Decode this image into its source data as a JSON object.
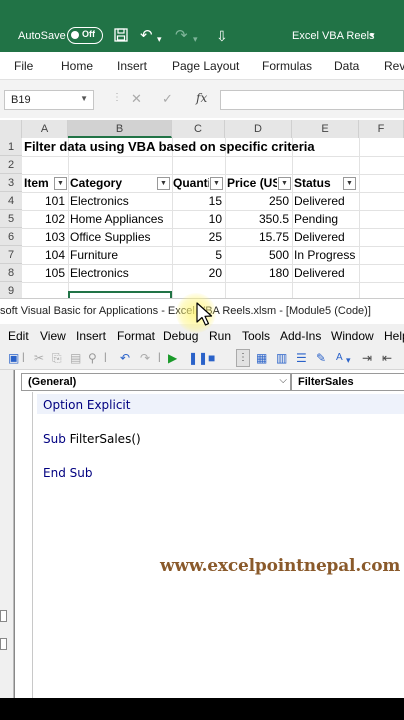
{
  "excel": {
    "autosave_label": "AutoSave",
    "autosave_state": "Off",
    "window_title": "Excel VBA Reels",
    "ribbon_tabs": [
      "File",
      "Home",
      "Insert",
      "Page Layout",
      "Formulas",
      "Data",
      "Revi"
    ],
    "name_box": "B19",
    "fx_label": "fx",
    "columns": [
      "A",
      "B",
      "C",
      "D",
      "E",
      "F"
    ],
    "row_numbers": [
      "1",
      "2",
      "3",
      "4",
      "5",
      "6",
      "7",
      "8",
      "9"
    ],
    "sheet_title": "Filter data using VBA based on specific criteria",
    "table": {
      "headers": [
        "Item",
        "Category",
        "Quanti",
        "Price (US",
        "Status"
      ],
      "rows": [
        [
          "101",
          "Electronics",
          "15",
          "250",
          "Delivered"
        ],
        [
          "102",
          "Home Appliances",
          "10",
          "350.5",
          "Pending"
        ],
        [
          "103",
          "Office Supplies",
          "25",
          "15.75",
          "Delivered"
        ],
        [
          "104",
          "Furniture",
          "5",
          "500",
          "In Progress"
        ],
        [
          "105",
          "Electronics",
          "20",
          "180",
          "Delivered"
        ]
      ]
    }
  },
  "vbe": {
    "window_title": "soft Visual Basic for Applications - Excel VBA Reels.xlsm - [Module5 (Code)]",
    "menu": [
      "Edit",
      "View",
      "Insert",
      "Format",
      "Debug",
      "Run",
      "Tools",
      "Add-Ins",
      "Window",
      "Help"
    ],
    "object_combo": "(General)",
    "procedure_combo": "FilterSales",
    "code": {
      "line1": "Option Explicit",
      "sub_kw": "Sub",
      "sub_name": " FilterSales()",
      "end_sub": "End Sub"
    }
  },
  "watermark": "www.excelpointnepal.com",
  "colors": {
    "excel_green": "#217346",
    "vba_keyword": "#000080",
    "watermark": "#8a5a2b"
  }
}
